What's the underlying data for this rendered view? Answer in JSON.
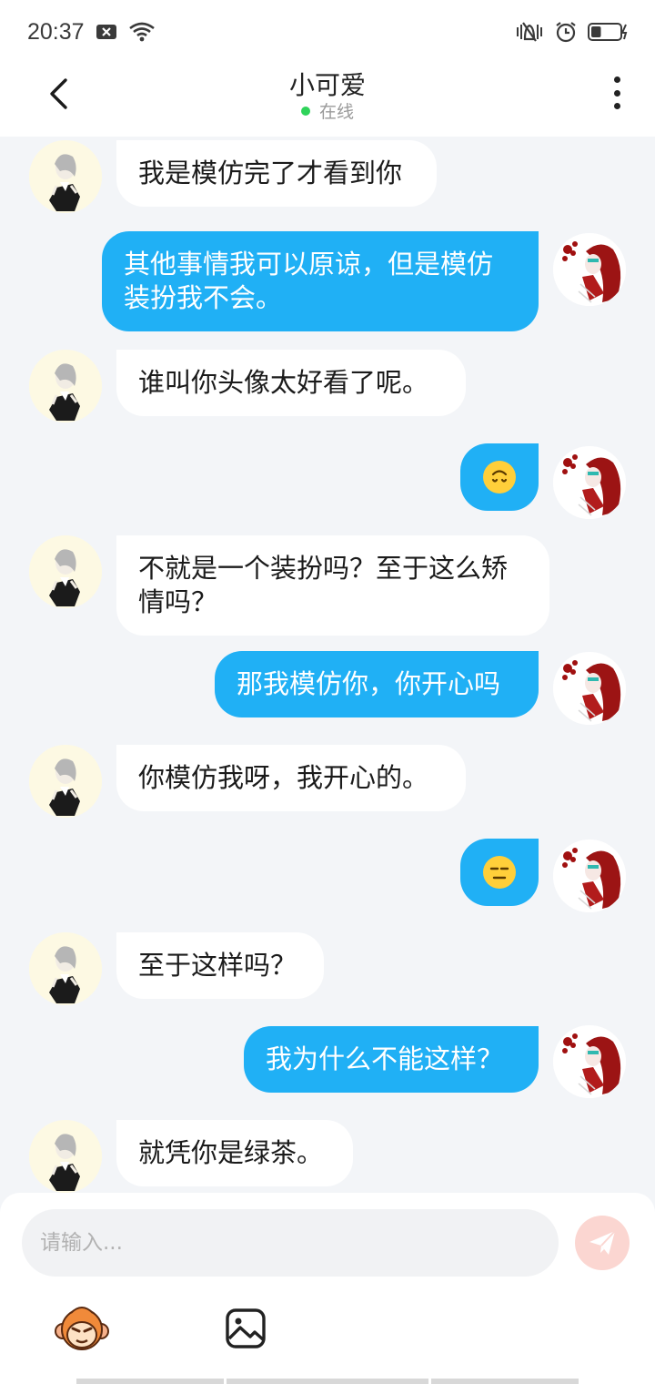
{
  "status_bar": {
    "time": "20:37",
    "left_icons": [
      "notification-x-icon",
      "wifi-icon"
    ],
    "right_icons": [
      "vibrate-mute-icon",
      "alarm-icon",
      "battery-charging-icon"
    ],
    "battery_level": 0.35
  },
  "header": {
    "title": "小可爱",
    "status": "在线",
    "status_color": "#2fd35a",
    "back_icon": "chevron-left-icon",
    "more_icon": "more-vertical-icon"
  },
  "colors": {
    "accent": "#20b0f5",
    "background": "#f3f5f8",
    "send_button": "#fbd6d1"
  },
  "messages": [
    {
      "side": "left",
      "lines": [
        "我是模仿完了才看到你"
      ]
    },
    {
      "side": "right",
      "lines": [
        "其他事情我可以原谅，但是模仿",
        "装扮我不会。"
      ]
    },
    {
      "side": "left",
      "lines": [
        "谁叫你头像太好看了呢。"
      ]
    },
    {
      "side": "right",
      "emoji": "upside-down-face-emoji"
    },
    {
      "side": "left",
      "lines": [
        "不就是一个装扮吗？至于这么矫",
        "情吗？"
      ]
    },
    {
      "side": "right",
      "lines": [
        "那我模仿你，你开心吗"
      ]
    },
    {
      "side": "left",
      "lines": [
        "你模仿我呀，我开心的。"
      ]
    },
    {
      "side": "right",
      "emoji": "expressionless-face-emoji"
    },
    {
      "side": "left",
      "lines": [
        "至于这样吗？"
      ]
    },
    {
      "side": "right",
      "lines": [
        "我为什么不能这样？"
      ]
    },
    {
      "side": "left",
      "lines": [
        "就凭你是绿茶。"
      ]
    }
  ],
  "composer": {
    "placeholder": "请输入...",
    "send_icon": "paper-plane-icon",
    "toolbar": [
      "emoji-monkey-icon",
      "image-icon"
    ]
  }
}
